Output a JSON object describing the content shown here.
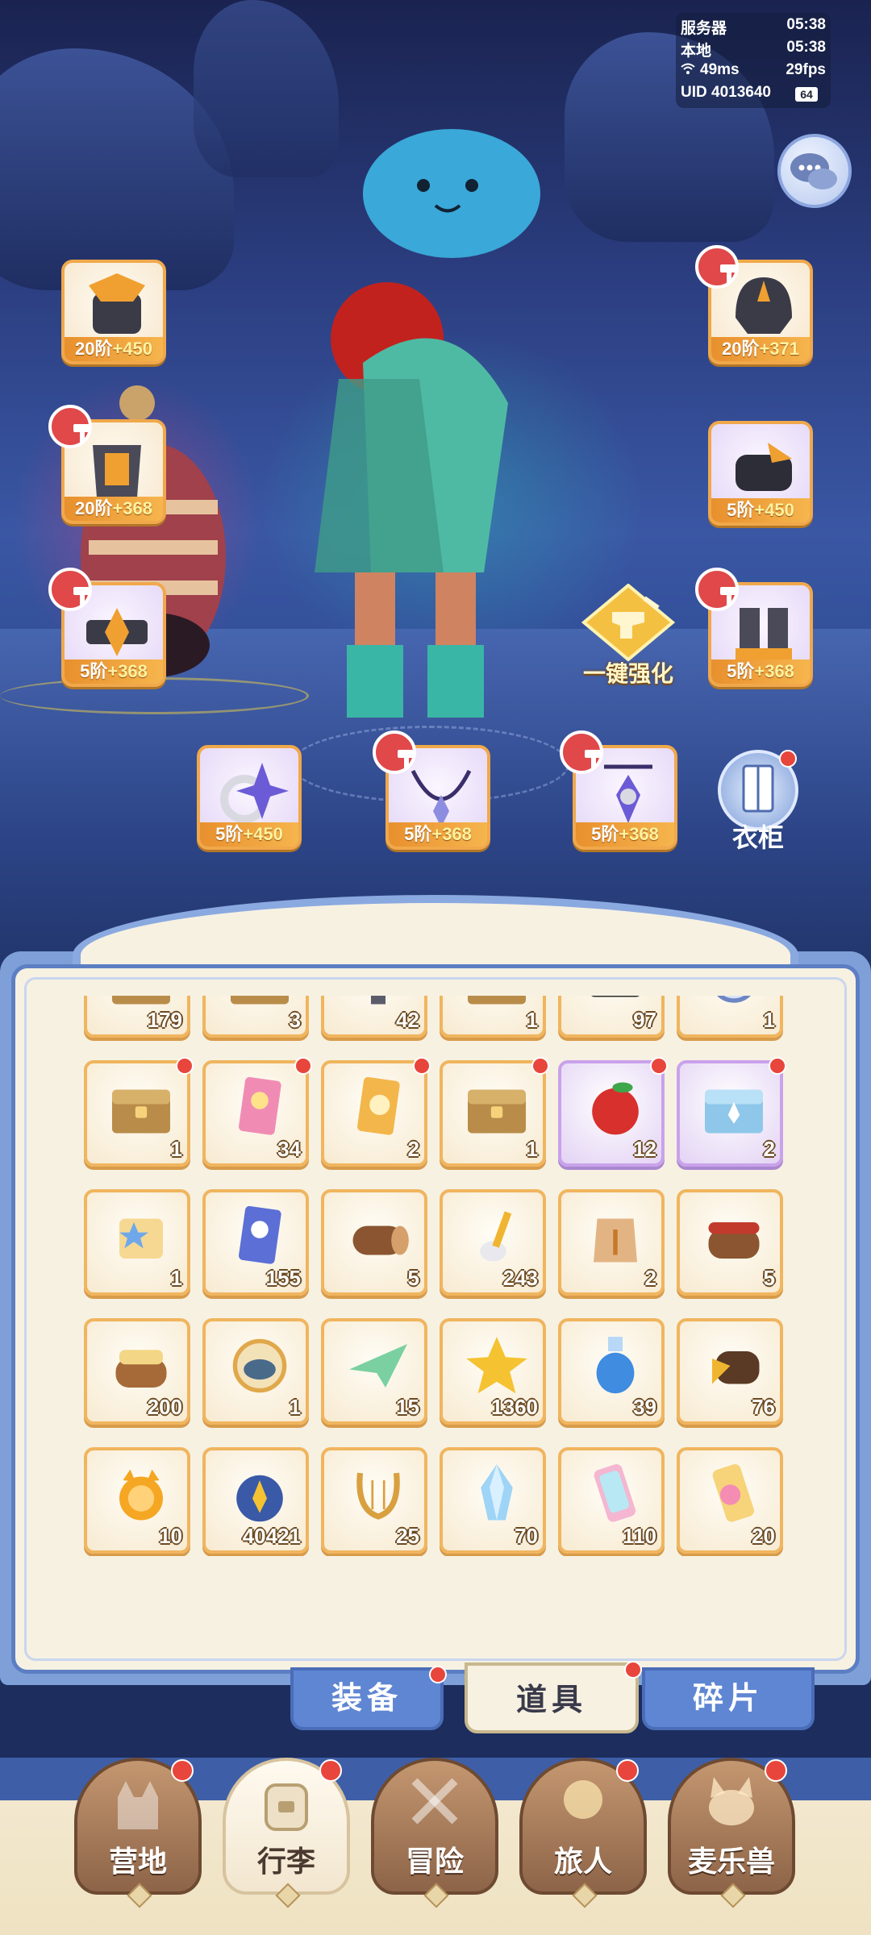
{
  "hud": {
    "server_label": "服务器",
    "server_time": "05:38",
    "local_label": "本地",
    "local_time": "05:38",
    "ping": "49ms",
    "fps": "29fps",
    "uid": "UID 4013640",
    "battery": "64"
  },
  "equipment": [
    {
      "id": "weapon",
      "icon": "weapon-icon",
      "tier": "20阶",
      "bonus": "+450",
      "hammer": false,
      "rarity": "gold"
    },
    {
      "id": "helmet",
      "icon": "helmet-icon",
      "tier": "20阶",
      "bonus": "+371",
      "hammer": true,
      "rarity": "gold"
    },
    {
      "id": "armor",
      "icon": "armor-icon",
      "tier": "20阶",
      "bonus": "+368",
      "hammer": true,
      "rarity": "gold"
    },
    {
      "id": "gauntlet",
      "icon": "gauntlet-icon",
      "tier": "5阶",
      "bonus": "+450",
      "hammer": false,
      "rarity": "purple"
    },
    {
      "id": "belt",
      "icon": "belt-icon",
      "tier": "5阶",
      "bonus": "+368",
      "hammer": true,
      "rarity": "purple"
    },
    {
      "id": "boots",
      "icon": "boots-icon",
      "tier": "5阶",
      "bonus": "+368",
      "hammer": true,
      "rarity": "purple"
    },
    {
      "id": "ring",
      "icon": "ring-icon",
      "tier": "5阶",
      "bonus": "+450",
      "hammer": false,
      "rarity": "purple"
    },
    {
      "id": "necklace",
      "icon": "necklace-icon",
      "tier": "5阶",
      "bonus": "+368",
      "hammer": true,
      "rarity": "purple"
    },
    {
      "id": "amulet",
      "icon": "amulet-icon",
      "tier": "5阶",
      "bonus": "+368",
      "hammer": true,
      "rarity": "purple"
    }
  ],
  "enhance_button": "一键强化",
  "wardrobe_button": "衣柜",
  "inventory": [
    {
      "icon": "chest-gold-icon",
      "qty": "179",
      "dot": false,
      "rarity": "gold"
    },
    {
      "icon": "chest-gold-icon",
      "qty": "3",
      "dot": false,
      "rarity": "gold"
    },
    {
      "icon": "tool-icon",
      "qty": "42",
      "dot": false,
      "rarity": "gold"
    },
    {
      "icon": "chest-gold-icon",
      "qty": "1",
      "dot": false,
      "rarity": "gold"
    },
    {
      "icon": "ticket-icon",
      "qty": "97",
      "dot": false,
      "rarity": "gold"
    },
    {
      "icon": "coin-icon",
      "qty": "1",
      "dot": false,
      "rarity": "gold"
    },
    {
      "icon": "chest-gold-icon",
      "qty": "1",
      "dot": true,
      "rarity": "gold"
    },
    {
      "icon": "scroll-card-icon",
      "qty": "34",
      "dot": true,
      "rarity": "gold"
    },
    {
      "icon": "question-card-icon",
      "qty": "2",
      "dot": true,
      "rarity": "gold"
    },
    {
      "icon": "chest-gold-icon",
      "qty": "1",
      "dot": true,
      "rarity": "gold"
    },
    {
      "icon": "apple-icon",
      "qty": "12",
      "dot": true,
      "rarity": "purple"
    },
    {
      "icon": "chest-blue-icon",
      "qty": "2",
      "dot": true,
      "rarity": "purple"
    },
    {
      "icon": "map-scroll-icon",
      "qty": "1",
      "dot": false,
      "rarity": "gold"
    },
    {
      "icon": "blue-ticket-icon",
      "qty": "155",
      "dot": false,
      "rarity": "gold"
    },
    {
      "icon": "log-icon",
      "qty": "5",
      "dot": false,
      "rarity": "gold"
    },
    {
      "icon": "spoon-icon",
      "qty": "243",
      "dot": false,
      "rarity": "gold"
    },
    {
      "icon": "seed-bag-icon",
      "qty": "2",
      "dot": false,
      "rarity": "gold"
    },
    {
      "icon": "cake-log-icon",
      "qty": "5",
      "dot": false,
      "rarity": "gold"
    },
    {
      "icon": "cheese-log-icon",
      "qty": "200",
      "dot": false,
      "rarity": "gold"
    },
    {
      "icon": "shark-badge-icon",
      "qty": "1",
      "dot": false,
      "rarity": "gold"
    },
    {
      "icon": "paper-plane-icon",
      "qty": "15",
      "dot": false,
      "rarity": "gold"
    },
    {
      "icon": "star-crystal-icon",
      "qty": "1360",
      "dot": false,
      "rarity": "gold"
    },
    {
      "icon": "potion-icon",
      "qty": "39",
      "dot": false,
      "rarity": "gold"
    },
    {
      "icon": "music-log-icon",
      "qty": "76",
      "dot": false,
      "rarity": "gold"
    },
    {
      "icon": "cat-coin-icon",
      "qty": "10",
      "dot": false,
      "rarity": "gold"
    },
    {
      "icon": "star-orb-icon",
      "qty": "40421",
      "dot": false,
      "rarity": "gold"
    },
    {
      "icon": "lyre-icon",
      "qty": "25",
      "dot": false,
      "rarity": "gold"
    },
    {
      "icon": "ice-crystal-icon",
      "qty": "70",
      "dot": false,
      "rarity": "gold"
    },
    {
      "icon": "rainbow-tube-icon",
      "qty": "110",
      "dot": false,
      "rarity": "gold"
    },
    {
      "icon": "rainbow-paint-icon",
      "qty": "20",
      "dot": false,
      "rarity": "gold"
    }
  ],
  "subtabs": [
    {
      "label": "装备",
      "active": false,
      "dot": true
    },
    {
      "label": "道具",
      "active": true,
      "dot": true
    },
    {
      "label": "碎片",
      "active": false,
      "dot": false
    }
  ],
  "nav": [
    {
      "label": "营地",
      "icon": "castle-icon",
      "active": false,
      "dot": true
    },
    {
      "label": "行李",
      "icon": "backpack-icon",
      "active": true,
      "dot": true
    },
    {
      "label": "冒险",
      "icon": "swords-icon",
      "active": false,
      "dot": false
    },
    {
      "label": "旅人",
      "icon": "traveler-icon",
      "active": false,
      "dot": true
    },
    {
      "label": "麦乐兽",
      "icon": "cat-pet-icon",
      "active": false,
      "dot": true
    }
  ],
  "colors": {
    "accent_gold": "#f0a84a",
    "accent_purple": "#c9a2ea",
    "badge_red": "#e8463c",
    "panel_blue": "#5f86d2"
  }
}
